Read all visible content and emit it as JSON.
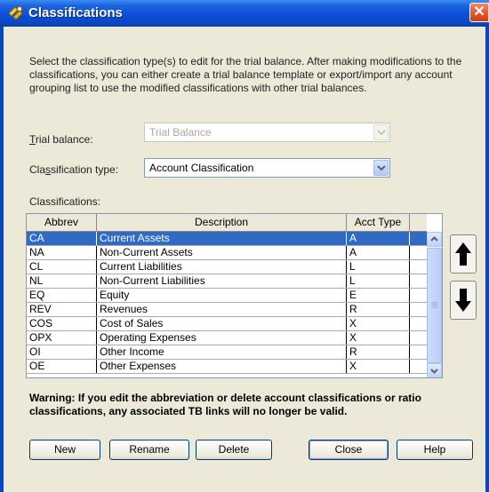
{
  "window": {
    "title": "Classifications",
    "close_glyph": "✕"
  },
  "intro": "Select the classification type(s) to edit for the trial balance.  After making modifications to the classifications, you can either create a trial balance template or export/import any account grouping list to use the modified classifications with other trial balances.",
  "trial_balance": {
    "label_first": "T",
    "label_rest": "rial balance:",
    "value": "Trial Balance",
    "enabled": false
  },
  "classification_type": {
    "label_a": "Cla",
    "label_u": "s",
    "label_b": "sification type:",
    "value": "Account Classification"
  },
  "classifications_label": "Classifications:",
  "grid": {
    "columns": [
      "Abbrev",
      "Description",
      "Acct Type"
    ],
    "rows": [
      {
        "abbrev": "CA",
        "description": "Current Assets",
        "acct_type": "A",
        "selected": true
      },
      {
        "abbrev": "NA",
        "description": "Non-Current Assets",
        "acct_type": "A"
      },
      {
        "abbrev": "CL",
        "description": "Current Liabilities",
        "acct_type": "L"
      },
      {
        "abbrev": "NL",
        "description": "Non-Current Liabilities",
        "acct_type": "L"
      },
      {
        "abbrev": "EQ",
        "description": "Equity",
        "acct_type": "E"
      },
      {
        "abbrev": "REV",
        "description": "Revenues",
        "acct_type": "R"
      },
      {
        "abbrev": "COS",
        "description": "Cost of Sales",
        "acct_type": "X"
      },
      {
        "abbrev": "OPX",
        "description": "Operating Expenses",
        "acct_type": "X"
      },
      {
        "abbrev": "OI",
        "description": "Other Income",
        "acct_type": "R"
      },
      {
        "abbrev": "OE",
        "description": "Other Expenses",
        "acct_type": "X"
      }
    ]
  },
  "warning": "Warning:  If you edit the abbreviation or delete account classifications or ratio classifications, any associated TB links will no longer be valid.",
  "buttons": {
    "new": "New",
    "rename": "Rename",
    "delete": "Delete",
    "close": "Close",
    "help": "Help"
  },
  "colors": {
    "title_bar": "#0b47c2",
    "selection": "#316ac5",
    "dialog_bg": "#ece9d8"
  }
}
